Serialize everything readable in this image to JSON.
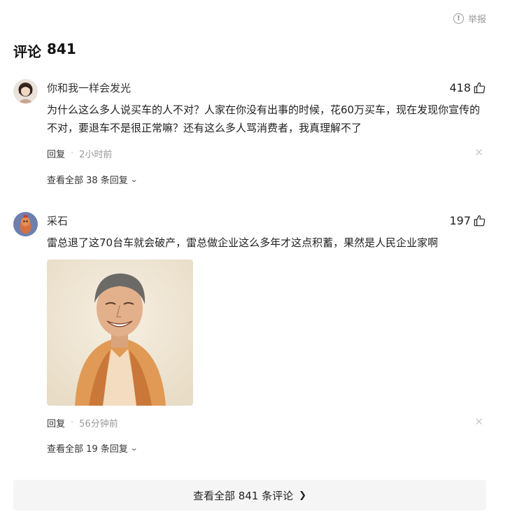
{
  "report": {
    "label": "举报"
  },
  "section": {
    "title": "评论",
    "count": "841"
  },
  "comments": [
    {
      "username": "你和我一样会发光",
      "likes": "418",
      "text": "为什么这么多人说买车的人不对？人家在你没有出事的时候，花60万买车，现在发现你宣传的不对，要退车不是很正常嘛？还有这么多人骂消费者，我真理解不了",
      "reply_label": "回复",
      "separator": "·",
      "time": "2小时前",
      "view_replies": "查看全部 38 条回复"
    },
    {
      "username": "采石",
      "likes": "197",
      "text": "雷总退了这70台车就会破产，雷总做企业这么多年才这点积蓄，果然是人民企业家啊",
      "reply_label": "回复",
      "separator": "·",
      "time": "56分钟前",
      "view_replies": "查看全部 19 条回复",
      "has_image": true
    }
  ],
  "view_all": {
    "label": "查看全部 841 条评论"
  },
  "colors": {
    "muted": "#999999",
    "button_bg": "#f5f5f5",
    "text": "#222222"
  },
  "icons": [
    "info-circle-icon",
    "thumbs-up-icon",
    "close-icon",
    "chevron-down-icon",
    "chevron-right-icon"
  ]
}
